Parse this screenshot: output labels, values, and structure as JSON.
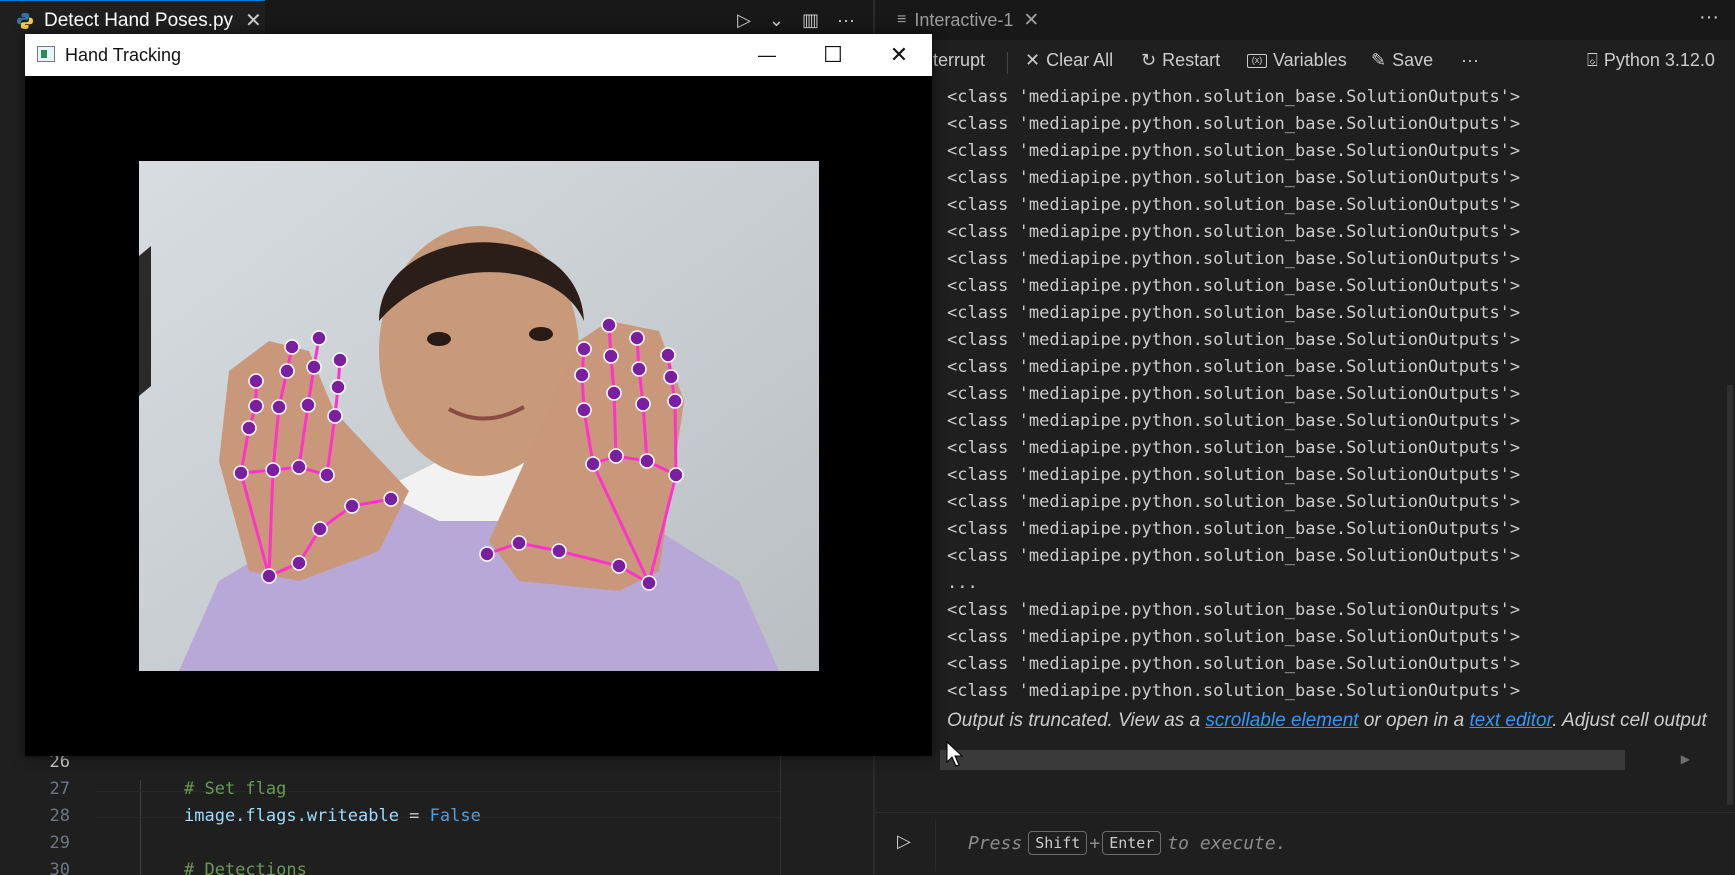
{
  "editor": {
    "tab_label": "Detect Hand Poses.py",
    "tab_close": "✕",
    "actions": {
      "run": "▷",
      "run_menu": "⌄",
      "split": "▥",
      "more": "···"
    },
    "lines": [
      {
        "num": "26",
        "text": ""
      },
      {
        "num": "27",
        "comment": "# Set flag"
      },
      {
        "num": "28",
        "var": "image.flags.writeable",
        "op": " = ",
        "kw": "False"
      },
      {
        "num": "29",
        "text": ""
      },
      {
        "num": "30",
        "comment": "# Detections"
      }
    ]
  },
  "interactive": {
    "tab_label": "Interactive-1",
    "tab_close": "✕",
    "more": "···",
    "toolbar": {
      "interrupt": "terrupt",
      "clear_all": "Clear All",
      "restart": "Restart",
      "variables": "Variables",
      "save": "Save",
      "more": "···",
      "kernel": "Python 3.12.0"
    },
    "output_lines_top": [
      "<class 'mediapipe.python.solution_base.SolutionOutputs'>",
      "<class 'mediapipe.python.solution_base.SolutionOutputs'>",
      "<class 'mediapipe.python.solution_base.SolutionOutputs'>",
      "<class 'mediapipe.python.solution_base.SolutionOutputs'>",
      "<class 'mediapipe.python.solution_base.SolutionOutputs'>",
      "<class 'mediapipe.python.solution_base.SolutionOutputs'>",
      "<class 'mediapipe.python.solution_base.SolutionOutputs'>",
      "<class 'mediapipe.python.solution_base.SolutionOutputs'>",
      "<class 'mediapipe.python.solution_base.SolutionOutputs'>",
      "<class 'mediapipe.python.solution_base.SolutionOutputs'>",
      "<class 'mediapipe.python.solution_base.SolutionOutputs'>",
      "<class 'mediapipe.python.solution_base.SolutionOutputs'>",
      "<class 'mediapipe.python.solution_base.SolutionOutputs'>",
      "<class 'mediapipe.python.solution_base.SolutionOutputs'>",
      "<class 'mediapipe.python.solution_base.SolutionOutputs'>",
      "<class 'mediapipe.python.solution_base.SolutionOutputs'>",
      "<class 'mediapipe.python.solution_base.SolutionOutputs'>",
      "<class 'mediapipe.python.solution_base.SolutionOutputs'>",
      "...",
      "<class 'mediapipe.python.solution_base.SolutionOutputs'>",
      "<class 'mediapipe.python.solution_base.SolutionOutputs'>",
      "<class 'mediapipe.python.solution_base.SolutionOutputs'>",
      "<class 'mediapipe.python.solution_base.SolutionOutputs'>"
    ],
    "truncated": {
      "prefix": "Output is truncated. View as a ",
      "link1": "scrollable element",
      "middle": " or open in a ",
      "link2": "text editor",
      "suffix": ". Adjust cell output"
    },
    "input": {
      "press": "Press",
      "key1": "Shift",
      "plus": "+",
      "key2": "Enter",
      "suffix": "to execute."
    }
  },
  "hand_window": {
    "title": "Hand Tracking",
    "minimize": "—",
    "maximize": "☐",
    "close": "✕"
  },
  "colors": {
    "landmark_line": "#ff33cc",
    "landmark_point": "#7a1fa0",
    "link": "#3794ff",
    "accent": "#0078d4"
  }
}
